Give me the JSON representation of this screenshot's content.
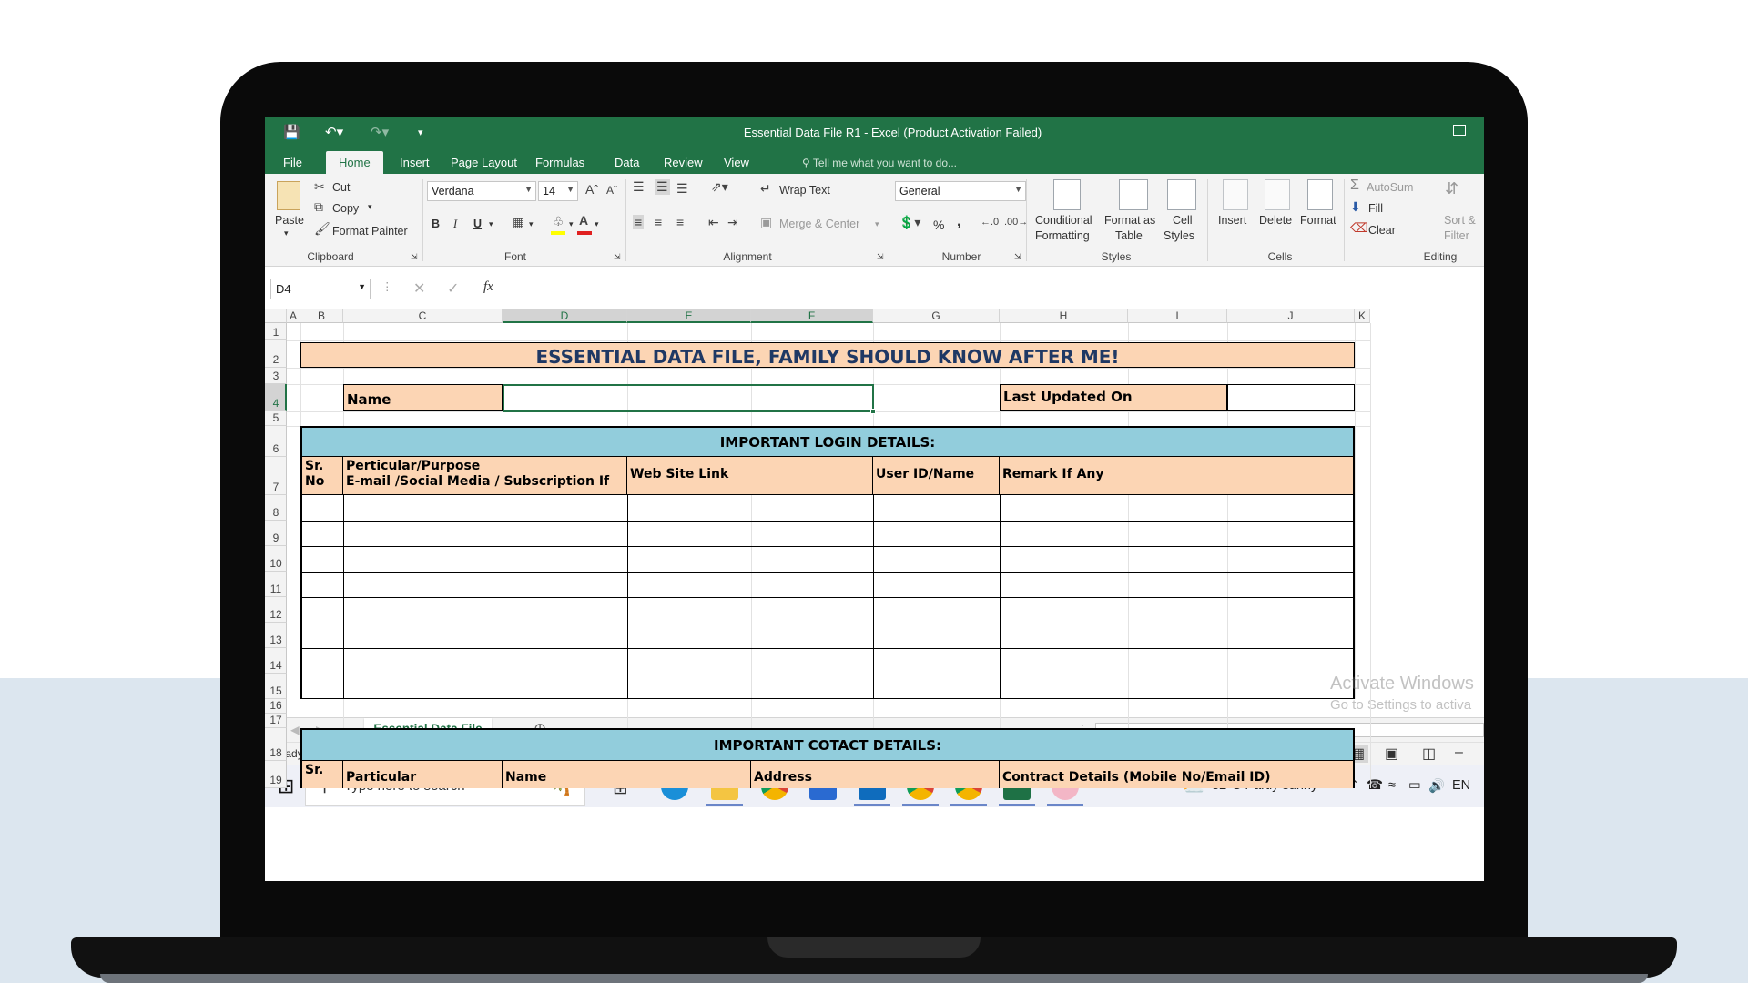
{
  "excel": {
    "window_title": "Essential Data File R1 - Excel (Product Activation Failed)",
    "tabs": [
      "File",
      "Home",
      "Insert",
      "Page Layout",
      "Formulas",
      "Data",
      "Review",
      "View"
    ],
    "active_tab": "Home",
    "tell_me": "Tell me what you want to do...",
    "ribbon": {
      "clipboard": {
        "label": "Clipboard",
        "paste": "Paste",
        "cut": "Cut",
        "copy": "Copy",
        "format_painter": "Format Painter"
      },
      "font": {
        "label": "Font",
        "name": "Verdana",
        "size": "14",
        "bold": "B",
        "italic": "I",
        "underline": "U"
      },
      "alignment": {
        "label": "Alignment",
        "wrap_text": "Wrap Text",
        "merge_center": "Merge & Center"
      },
      "number": {
        "label": "Number",
        "format": "General",
        "percent": "%",
        "comma": ","
      },
      "styles": {
        "label": "Styles",
        "conditional": "Conditional",
        "conditional2": "Formatting",
        "format_as": "Format as",
        "format_as2": "Table",
        "cell": "Cell",
        "cell2": "Styles"
      },
      "cells": {
        "label": "Cells",
        "insert": "Insert",
        "delete": "Delete",
        "format": "Format"
      },
      "editing": {
        "label": "Editing",
        "autosum": "AutoSum",
        "fill": "Fill",
        "clear": "Clear",
        "sort": "Sort &",
        "sort2": "Filter"
      }
    },
    "name_box": "D4",
    "fx": "fx",
    "columns": [
      "A",
      "B",
      "C",
      "D",
      "E",
      "F",
      "G",
      "H",
      "I",
      "J",
      "K"
    ],
    "rows": [
      "1",
      "2",
      "3",
      "4",
      "5",
      "6",
      "7",
      "8",
      "9",
      "10",
      "11",
      "12",
      "13",
      "14",
      "15",
      "16",
      "17",
      "18",
      "19"
    ],
    "sheet": {
      "title": "ESSENTIAL DATA FILE, FAMILY SHOULD KNOW AFTER ME!",
      "name_label": "Name",
      "last_updated_label": "Last Updated On",
      "login_section": "IMPORTANT LOGIN DETAILS:",
      "login_headers": {
        "sr": "Sr.",
        "no": "No",
        "particular": "Perticular/Purpose",
        "particular2": "E-mail /Social Media / Subscription If",
        "website": "Web Site Link",
        "userid": "User ID/Name",
        "remark": "Remark If Any"
      },
      "contact_section": "IMPORTANT COTACT DETAILS:",
      "contact_headers": {
        "sr": "Sr.",
        "particular": "Particular",
        "name": "Name",
        "address": "Address",
        "contact": "Contract Details (Mobile No/Email ID)"
      }
    },
    "sheet_tab": "Essential Data File",
    "status": "Ready",
    "watermark": {
      "line1": "Activate Windows",
      "line2": "Go to Settings to activa"
    }
  },
  "taskbar": {
    "search_placeholder": "Type here to search",
    "weather": "32°C  Partly sunny",
    "lang": "EN"
  },
  "colors": {
    "excel_green": "#217346",
    "peach": "#fcd5b4",
    "section_blue": "#92cddc",
    "title_navy": "#1f3864"
  }
}
